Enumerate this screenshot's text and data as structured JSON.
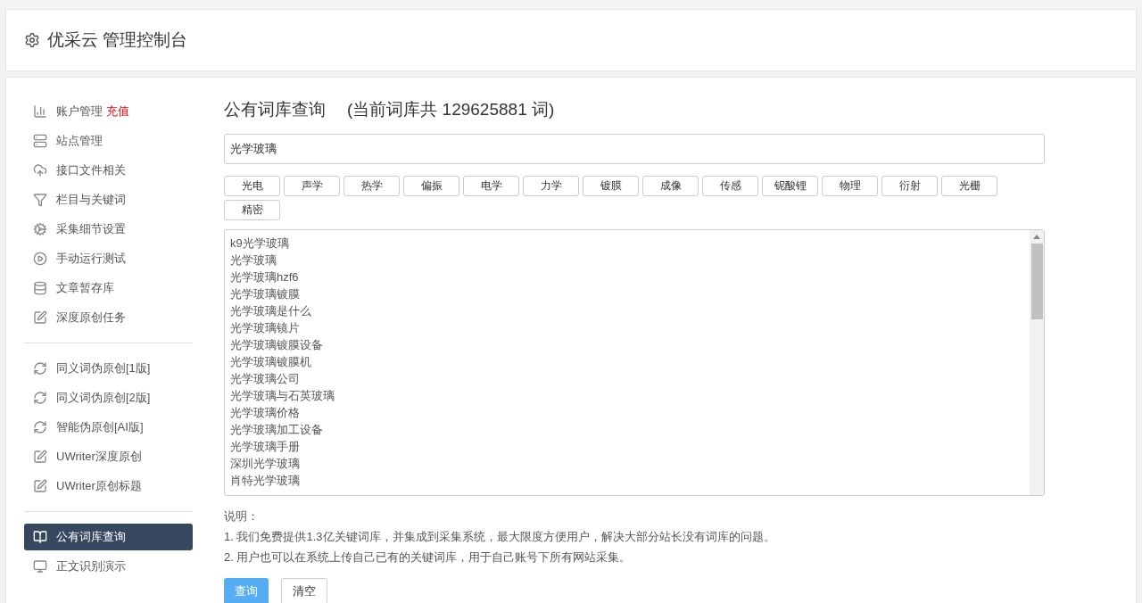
{
  "header": {
    "title": "优采云 管理控制台"
  },
  "sidebar": {
    "groups": [
      [
        {
          "label": "账户管理",
          "badge": "充值",
          "selected": false
        },
        {
          "label": "站点管理",
          "selected": false
        },
        {
          "label": "接口文件相关",
          "selected": false
        },
        {
          "label": "栏目与关键词",
          "selected": false
        },
        {
          "label": "采集细节设置",
          "selected": false
        },
        {
          "label": "手动运行测试",
          "selected": false
        },
        {
          "label": "文章暂存库",
          "selected": false
        },
        {
          "label": "深度原创任务",
          "selected": false
        }
      ],
      [
        {
          "label": "同义词伪原创[1版]",
          "selected": false
        },
        {
          "label": "同义词伪原创[2版]",
          "selected": false
        },
        {
          "label": "智能伪原创[AI版]",
          "selected": false
        },
        {
          "label": "UWriter深度原创",
          "selected": false
        },
        {
          "label": "UWriter原创标题",
          "selected": false
        }
      ],
      [
        {
          "label": "公有词库查询",
          "selected": true
        },
        {
          "label": "正文识别演示",
          "selected": false
        }
      ]
    ]
  },
  "main": {
    "title": "公有词库查询",
    "count_note": "(当前词库共 129625881 词)",
    "search": {
      "value": "光学玻璃"
    },
    "tags": [
      "光电",
      "声学",
      "热学",
      "偏振",
      "电学",
      "力学",
      "镀膜",
      "成像",
      "传感",
      "铌酸锂",
      "物理",
      "衍射",
      "光栅",
      "精密"
    ],
    "results": [
      "k9光学玻璃",
      "光学玻璃",
      "光学玻璃hzf6",
      "光学玻璃镀膜",
      "光学玻璃是什么",
      "光学玻璃镜片",
      "光学玻璃镀膜设备",
      "光学玻璃镀膜机",
      "光学玻璃公司",
      "光学玻璃与石英玻璃",
      "光学玻璃价格",
      "光学玻璃加工设备",
      "光学玻璃手册",
      "深圳光学玻璃",
      "肖特光学玻璃"
    ],
    "notes_title": "说明：",
    "notes": [
      "1. 我们免费提供1.3亿关键词库，并集成到采集系统，最大限度方便用户，解决大部分站长没有词库的问题。",
      "2. 用户也可以在系统上传自己已有的关键词库，用于自己账号下所有网站采集。"
    ],
    "buttons": [
      {
        "label": "查询",
        "kind": "primary"
      },
      {
        "label": "清空",
        "kind": "default"
      }
    ]
  }
}
